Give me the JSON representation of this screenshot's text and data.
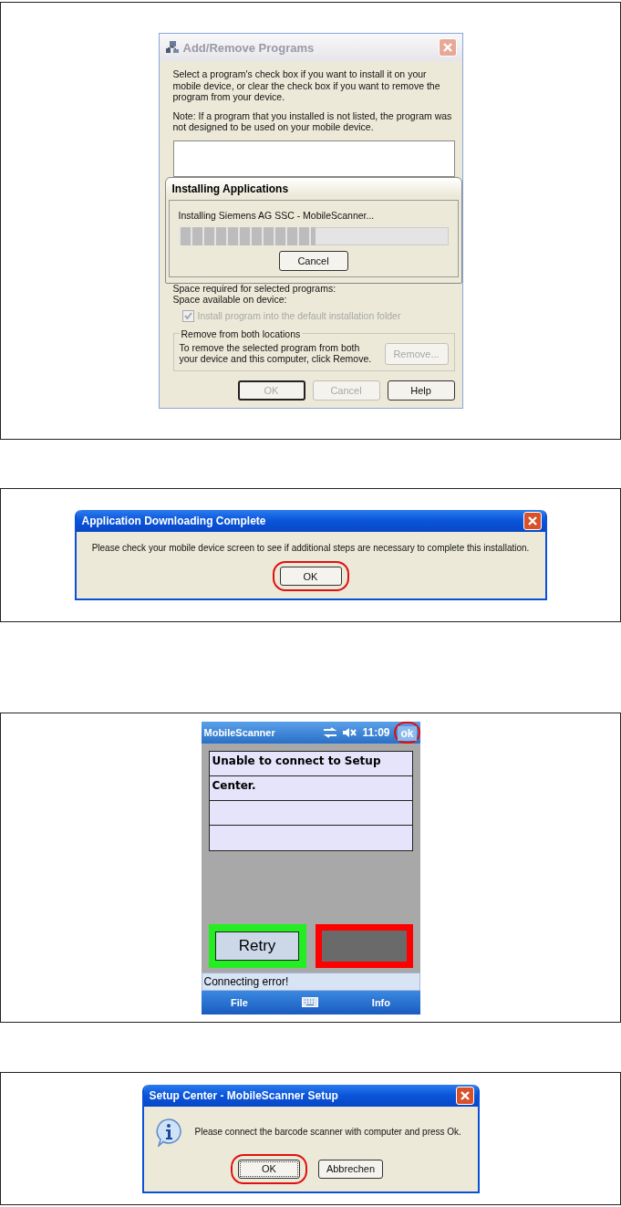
{
  "add_remove_dialog": {
    "title": "Add/Remove Programs",
    "intro": "Select a program's check box if you want to install it on your mobile device, or clear the check box if you want to remove the program from your device.",
    "note": "Note:  If a program that you installed is not listed, the program was not designed to be used on your mobile device.",
    "installing_dialog": {
      "title": "Installing Applications",
      "message": "Installing Siemens AG SSC - MobileScanner...",
      "level": 0.51,
      "button": "Cancel"
    },
    "space_required": "Space required for selected programs:",
    "space_available": "Space available on device:",
    "default_folder": {
      "label": "Install program into the default installation folder",
      "checked": true,
      "disabled": true
    },
    "remove_group": {
      "legend": "Remove from both locations",
      "text": "To remove the selected program from both your device and this computer, click Remove.",
      "button": {
        "label": "Remove...",
        "disabled": true
      }
    },
    "buttons": [
      {
        "label": "OK",
        "disabled": true,
        "default": true
      },
      {
        "label": "Cancel",
        "disabled": true,
        "default": false
      },
      {
        "label": "Help",
        "disabled": false,
        "default": false
      }
    ]
  },
  "download_complete_dialog": {
    "title": "Application Downloading Complete",
    "message": "Please check your mobile device screen to see if additional steps are necessary to complete this installation.",
    "buttons": [
      {
        "label": "OK",
        "callout": true
      }
    ]
  },
  "mobile_screen": {
    "title": "MobileScanner",
    "time": "11:09",
    "ok": {
      "label": "ok",
      "callout": true
    },
    "rows": [
      {
        "kind": "text",
        "text": "Unable to connect to Setup"
      },
      {
        "kind": "text",
        "text": "Center."
      },
      {
        "kind": "empty"
      },
      {
        "kind": "empty"
      }
    ],
    "actions": [
      {
        "label": "Retry",
        "color": "#22ee22"
      },
      {
        "color": "#ff0000"
      }
    ],
    "status": "Connecting error!",
    "softkeys": [
      "File",
      "Info"
    ]
  },
  "setup_dialog": {
    "title": "Setup Center - MobileScanner Setup",
    "message": "Please connect the barcode scanner with computer and press Ok.",
    "buttons": [
      {
        "label": "OK",
        "callout": true
      },
      {
        "label": "Abbrechen",
        "callout": false
      }
    ]
  }
}
